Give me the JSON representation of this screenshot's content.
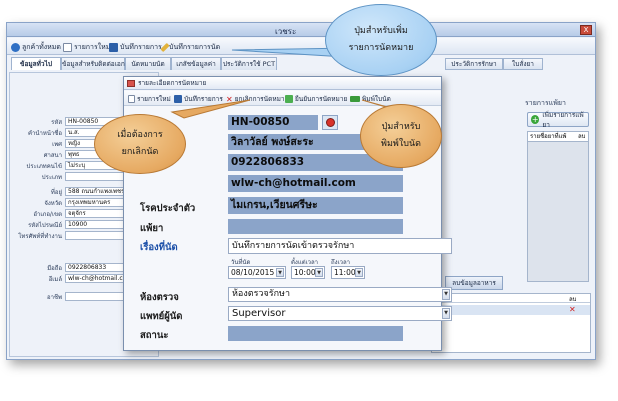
{
  "main_window": {
    "title": "เวชระ",
    "close_label": "X",
    "toolbar": [
      "ลูกค้าทั้งหมด",
      "รายการใหม่",
      "บันทึกรายการ",
      "บันทึกรายการนัด"
    ],
    "tabs": [
      "ข้อมูลทั่วไป",
      "ข้อมูลสำหรับติดต่อเอกสาร",
      "นัดหมายนัด",
      "เภสัชข้อมูลค่า",
      "ประวัติการใช้ PCT"
    ],
    "right_tabs": [
      "ประวัติการรักษา",
      "ใบสั่งยา"
    ]
  },
  "left_form": [
    {
      "label": "รหัส",
      "value": "HN-00850"
    },
    {
      "label": "คำนำหน้าชื่อ",
      "value": "น.ส."
    },
    {
      "label": "เพศ",
      "value": "หญิง"
    },
    {
      "label": "ศาสนา",
      "value": "พุทธ"
    },
    {
      "label": "ประเภทคนไข้",
      "value": "ไม่ระบุ"
    },
    {
      "label": "ประเภท",
      "value": ""
    },
    {
      "label": "ที่อยู่",
      "value": "588 ถนนกำแพงเพชร2"
    },
    {
      "label": "จังหวัด",
      "value": "กรุงเทพมหานคร"
    },
    {
      "label": "อำเภอ/เขต",
      "value": "จตุจักร"
    },
    {
      "label": "รหัสไปรษณีย์",
      "value": "10900"
    },
    {
      "label": "โทรศัพท์ที่ทำงาน",
      "value": ""
    },
    {
      "label": "มือถือ",
      "value": "0922806833"
    },
    {
      "label": "อีเมล์",
      "value": "wlw-ch@hotmail.com"
    },
    {
      "label": "อาชีพ",
      "value": ""
    }
  ],
  "drug_panel": {
    "title": "รายการแพ้ยา",
    "add_button": "เพิ่มรายการแพ้ยา",
    "col_name": "รายชื่อยาที่แพ้",
    "col_delete": "ลบ"
  },
  "bottom_right": {
    "button": "ลบข้อมูลอาหาร",
    "col_name": "ชื่อ",
    "col_delete": "ลบ",
    "delete_mark": "✕"
  },
  "dialog": {
    "title": "รายละเอียดการนัดหมาย",
    "toolbar": [
      "รายการใหม่",
      "บันทึกรายการ",
      "ยกเลิกการนัดหมาย",
      "ยืนยันการนัดหมาย",
      "พิมพ์ใบนัด"
    ],
    "hn": "HN-00850",
    "name": "วิลาวัลย์ พงษ์สะระ",
    "phone": "0922806833",
    "email": "wlw-ch@hotmail.com",
    "disease_label": "โรคประจำตัว",
    "disease_value": "ไมเกรน,เวียนศรีษะ",
    "allergy_label": "แพ้ยา",
    "topic_label": "เรื่องที่นัด",
    "topic_value": "บันทึกรายการนัดเข้าตรวจรักษา",
    "date_label": "วันที่นัด",
    "date_value": "08/10/2015",
    "from_label": "ตั้งแต่เวลา",
    "from_value": "10:00",
    "to_label": "ถึงเวลา",
    "to_value": "11:00",
    "room_label": "ห้องตรวจ",
    "room_value": "ห้องตรวจรักษา",
    "doctor_label": "แพทย์ผู้นัด",
    "doctor_value": "Supervisor",
    "status_label": "สถานะ"
  },
  "callouts": {
    "add": "ปุ่มสำหรับเพิ่มรายการนัดหมาย",
    "cancel": "เมื่อต้องการยกเลิกนัด",
    "print": "ปุ่มสำหรับพิมพ์ใบนัด"
  },
  "colors": {
    "band_blue": "#8ba4c9",
    "callout_orange": "#e6a961",
    "callout_blue": "#a8d1f3",
    "label_blue": "#1b4fa8"
  }
}
